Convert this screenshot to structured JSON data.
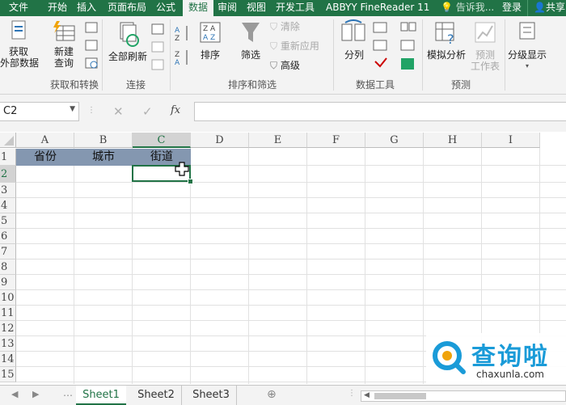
{
  "ribbon_tabs": [
    {
      "label": "文件"
    },
    {
      "label": "开始"
    },
    {
      "label": "插入"
    },
    {
      "label": "页面布局"
    },
    {
      "label": "公式"
    },
    {
      "label": "数据"
    },
    {
      "label": "审阅"
    },
    {
      "label": "视图"
    },
    {
      "label": "开发工具"
    },
    {
      "label": "ABBYY FineReader 11"
    }
  ],
  "tell_me": "告诉我...",
  "login": "登录",
  "share": "共享",
  "ribbon": {
    "get_data": {
      "line1": "获取",
      "line2": "外部数据"
    },
    "new_query": {
      "line1": "新建",
      "line2": "查询"
    },
    "refresh_all": "全部刷新",
    "sort": "排序",
    "filter": "筛选",
    "clear": "清除",
    "reapply": "重新应用",
    "advanced": "高级",
    "text_to_columns": "分列",
    "what_if": "模拟分析",
    "forecast": {
      "line1": "预测",
      "line2": "工作表"
    },
    "outline": "分级显示",
    "groups": {
      "get_transform": "获取和转换",
      "connections": "连接",
      "sort_filter": "排序和筛选",
      "data_tools": "数据工具",
      "forecast": "预测"
    }
  },
  "name_box": "C2",
  "fx": "fx",
  "columns": [
    "A",
    "B",
    "C",
    "D",
    "E",
    "F",
    "G",
    "H",
    "I"
  ],
  "rows": [
    "1",
    "2",
    "3",
    "4",
    "5",
    "6",
    "7",
    "8",
    "9",
    "10",
    "11",
    "12",
    "13",
    "14",
    "15"
  ],
  "cells": {
    "A1": "省份",
    "B1": "城市",
    "C1": "街道"
  },
  "header_fill": "#8497b0",
  "accent": "#217346",
  "sheets": [
    "Sheet1",
    "Sheet2",
    "Sheet3"
  ],
  "watermark": {
    "brand": "查询啦",
    "site": "chaxunla.com",
    "color": "#1a9bd8"
  }
}
